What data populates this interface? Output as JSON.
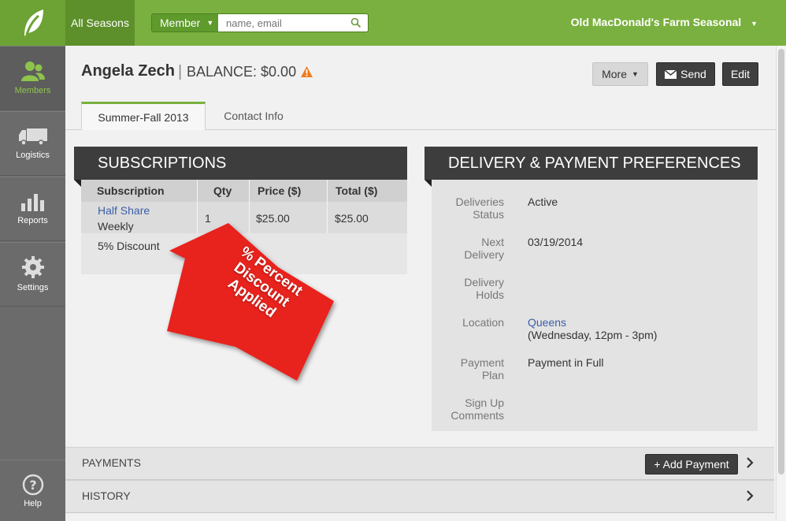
{
  "topbar": {
    "seasons_label": "All Seasons",
    "member_dropdown": "Member",
    "search_placeholder": "name, email",
    "farm_name": "Old MacDonald's Farm Seasonal"
  },
  "sidebar": {
    "items": [
      {
        "label": "Members",
        "icon": "members-icon",
        "active": true
      },
      {
        "label": "Logistics",
        "icon": "truck-icon",
        "active": false
      },
      {
        "label": "Reports",
        "icon": "bar-chart-icon",
        "active": false
      },
      {
        "label": "Settings",
        "icon": "gear-icon",
        "active": false
      }
    ],
    "help_label": "Help"
  },
  "header": {
    "member_name": "Angela Zech",
    "separator": "|",
    "balance": "BALANCE: $0.00",
    "more_label": "More",
    "send_label": "Send",
    "edit_label": "Edit"
  },
  "tabs": [
    {
      "label": "Summer-Fall 2013",
      "active": true
    },
    {
      "label": "Contact Info",
      "active": false
    }
  ],
  "subscriptions": {
    "title": "SUBSCRIPTIONS",
    "columns": [
      "Subscription",
      "Qty",
      "Price ($)",
      "Total ($)"
    ],
    "row": {
      "name": "Half Share",
      "frequency": "Weekly",
      "qty": "1",
      "price": "$25.00",
      "total": "$25.00"
    },
    "discount": "5% Discount"
  },
  "annotation": {
    "line1": "% Percent",
    "line2": "Discount",
    "line3": "Applied"
  },
  "delivery": {
    "title": "DELIVERY & PAYMENT PREFERENCES",
    "fields": [
      {
        "label1": "Deliveries",
        "label2": "Status",
        "value": "Active"
      },
      {
        "label1": "Next",
        "label2": "Delivery",
        "value": "03/19/2014"
      },
      {
        "label1": "Delivery",
        "label2": "Holds",
        "value": ""
      },
      {
        "label1": "",
        "label2": "Location",
        "value": "Queens",
        "value2": "(Wednesday, 12pm - 3pm)"
      },
      {
        "label1": "Payment",
        "label2": "Plan",
        "value": "Payment in Full"
      },
      {
        "label1": "Sign Up",
        "label2": "Comments",
        "value": ""
      }
    ]
  },
  "payments": {
    "title": "PAYMENTS",
    "add_label": "+ Add Payment"
  },
  "history": {
    "title": "HISTORY"
  },
  "colors": {
    "brand_green": "#7ab03f",
    "dark_panel": "#3d3d3d",
    "sidebar": "#6b6b6b",
    "annotation_red": "#e8201a",
    "link_blue": "#3b5ea8"
  }
}
